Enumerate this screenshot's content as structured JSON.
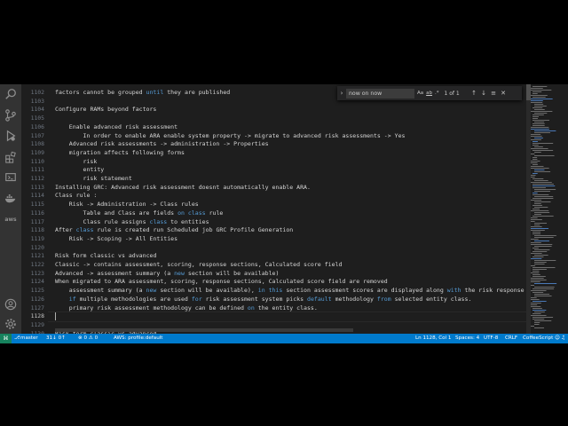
{
  "activity_bar": {
    "icons": [
      "search-icon",
      "source-control-icon",
      "run-debug-icon",
      "extensions-icon",
      "remote-explorer-icon",
      "docker-icon",
      "aws-icon",
      "account-icon",
      "manage-gear-icon"
    ],
    "aws_label": "aws"
  },
  "find_widget": {
    "query": "now on now",
    "case_label": "Aa",
    "word_label": "ab",
    "regex_label": ".*",
    "count": "1 of 1"
  },
  "editor": {
    "current_line": 1128,
    "lines": [
      {
        "n": "1102",
        "text": "factors cannot be grouped until they are published"
      },
      {
        "n": "1103",
        "text": ""
      },
      {
        "n": "1104",
        "text": "Configure RAMs beyond factors"
      },
      {
        "n": "1105",
        "text": ""
      },
      {
        "n": "1106",
        "text": "    Enable advanced risk assessment"
      },
      {
        "n": "1107",
        "text": "        In order to enable ARA enable system property -> migrate to advanced risk assessments -> Yes"
      },
      {
        "n": "1108",
        "text": "    Advanced risk assessments -> administration -> Properties"
      },
      {
        "n": "1109",
        "text": "    migration affects following forms"
      },
      {
        "n": "1110",
        "text": "        risk"
      },
      {
        "n": "1111",
        "text": "        entity"
      },
      {
        "n": "1112",
        "text": "        risk statement"
      },
      {
        "n": "1113",
        "text": "Installing GRC: Advanced risk assessment doesnt automatically enable ARA."
      },
      {
        "n": "1114",
        "text": "Class rule :"
      },
      {
        "n": "1115",
        "text": "    Risk -> Administration -> Class rules"
      },
      {
        "n": "1116",
        "text": "        Table and Class are fields on class rule"
      },
      {
        "n": "1117",
        "text": "        Class rule assigns class to entities"
      },
      {
        "n": "1118",
        "text": "After class rule is created run Scheduled job GRC Profile Generation"
      },
      {
        "n": "1119",
        "text": "    Risk -> Scoping -> All Entities"
      },
      {
        "n": "1120",
        "text": ""
      },
      {
        "n": "1121",
        "text": "Risk form classic vs advanced"
      },
      {
        "n": "1122",
        "text": "Classic -> contains assessment, scoring, response sections, Calculated score field"
      },
      {
        "n": "1123",
        "text": "Advanced -> assessment summary (a new section will be available)"
      },
      {
        "n": "1124",
        "text": "When migrated to ARA assessment, scoring, response sections, Calculated score field are removed"
      },
      {
        "n": "1125",
        "text": "    assessment summary (a new section will be available), in this section assessment scores are displayed along with the risk response"
      },
      {
        "n": "1126",
        "text": "    if multiple methodologies are used for risk assessment system picks default methodology from selected entity class."
      },
      {
        "n": "1127",
        "text": "    primary risk assessment methodology can be defined on the entity class."
      },
      {
        "n": "1128",
        "text": ""
      },
      {
        "n": "1129",
        "text": ""
      },
      {
        "n": "1130",
        "text": "Risk form classic vs advanced"
      }
    ]
  },
  "status_bar": {
    "branch": "master",
    "sync": "31↓ 0↑",
    "problems": "⊗ 0 ⚠ 0",
    "aws_profile": "AWS: profile:default",
    "position": "Ln 1128, Col 1",
    "spaces": "Spaces: 4",
    "encoding": "UTF-8",
    "eol": "CRLF",
    "language": "CoffeeScript"
  },
  "colors": {
    "editor_bg": "#1e1e1e",
    "status_bg": "#007acc",
    "keyword": "#569cd6",
    "text": "#d4d4d4"
  }
}
